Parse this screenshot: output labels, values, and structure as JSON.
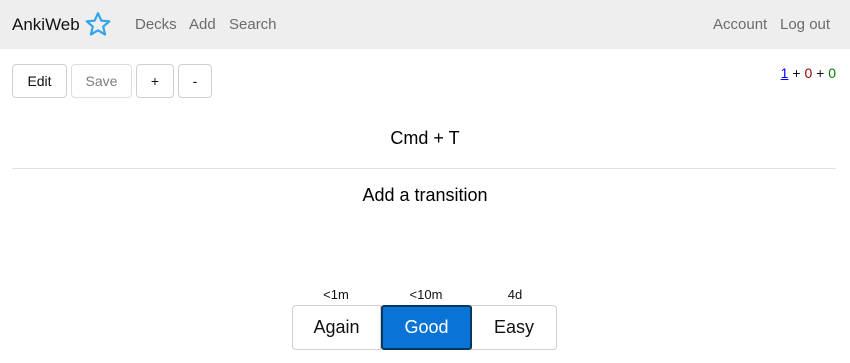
{
  "navbar": {
    "brand": "AnkiWeb",
    "links": {
      "decks": "Decks",
      "add": "Add",
      "search": "Search",
      "account": "Account",
      "logout": "Log out"
    }
  },
  "toolbar": {
    "edit_label": "Edit",
    "save_label": "Save",
    "plus_label": "+",
    "minus_label": "-"
  },
  "counts": {
    "new": "1",
    "sep1": " + ",
    "learn": "0",
    "sep2": " + ",
    "review": "0",
    "colors": {
      "new": "#0000ff",
      "learn": "#a00000",
      "review": "#008000"
    }
  },
  "card": {
    "question": "Cmd + T",
    "answer": "Add a transition"
  },
  "answer_buttons": [
    {
      "label": "Again",
      "interval": "<1m"
    },
    {
      "label": "Good",
      "interval": "<10m",
      "selected": true
    },
    {
      "label": "Easy",
      "interval": "4d"
    }
  ],
  "colors": {
    "navbar_bg": "#eeeeee",
    "accent": "#0a74d6",
    "logo": "#35a4e8"
  },
  "icons": {
    "logo": "star-outline-icon"
  }
}
